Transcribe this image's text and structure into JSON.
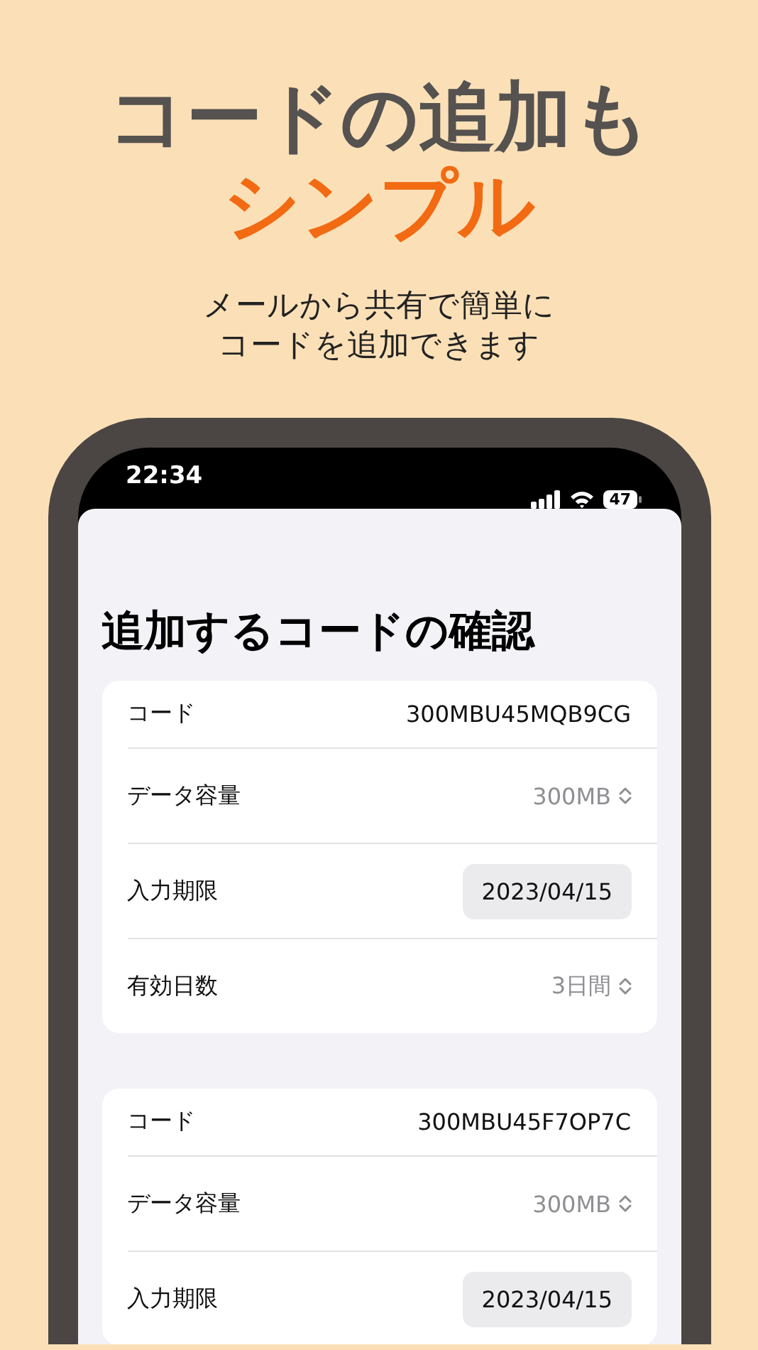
{
  "headline": {
    "line_1": "コードの追加も",
    "line_2": "シンプル"
  },
  "subtitle": {
    "line_1": "メールから共有で簡単に",
    "line_2": "コードを追加できます"
  },
  "status_bar": {
    "time": "22:34",
    "battery": "47"
  },
  "sheet": {
    "title": "追加するコードの確認",
    "cards": [
      {
        "rows": [
          {
            "kind": "text",
            "label": "コード",
            "value": "300MBU45MQB9CG"
          },
          {
            "kind": "picker",
            "label": "データ容量",
            "value": "300MB"
          },
          {
            "kind": "date",
            "label": "入力期限",
            "value": "2023/04/15"
          },
          {
            "kind": "picker",
            "label": "有効日数",
            "value": "3日間"
          }
        ]
      },
      {
        "rows": [
          {
            "kind": "text",
            "label": "コード",
            "value": "300MBU45F7OP7C"
          },
          {
            "kind": "picker",
            "label": "データ容量",
            "value": "300MB"
          },
          {
            "kind": "date",
            "label": "入力期限",
            "value": "2023/04/15"
          }
        ]
      }
    ]
  }
}
